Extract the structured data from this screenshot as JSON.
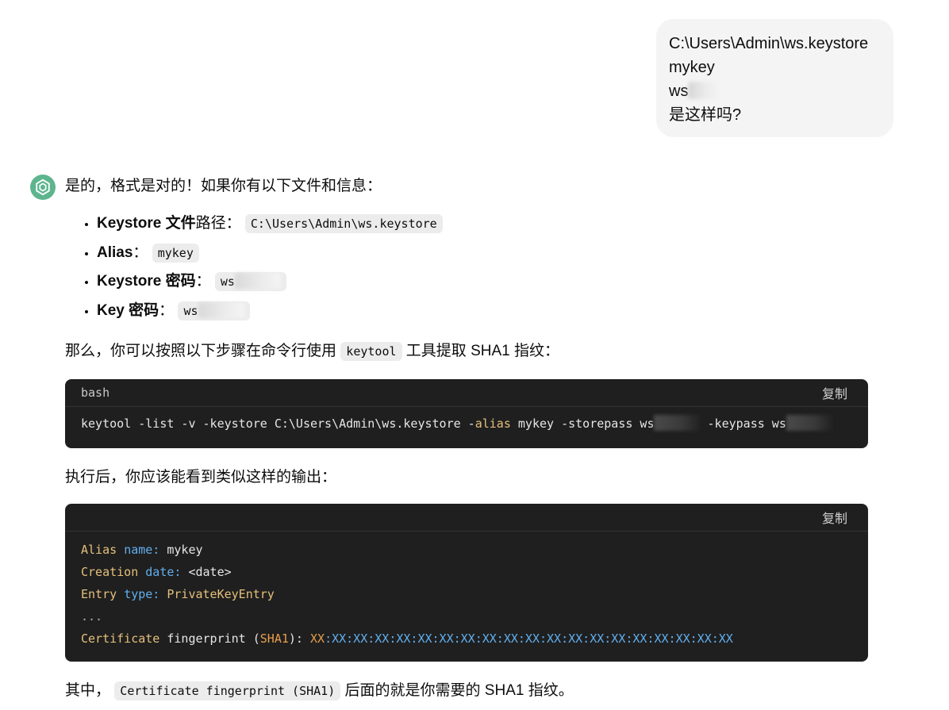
{
  "user_message": {
    "lines": [
      "C:\\Users\\Admin\\ws.keystore",
      "mykey",
      "ws",
      "是这样吗?"
    ]
  },
  "assistant": {
    "intro": "是的，格式是对的！如果你有以下文件和信息：",
    "items": [
      {
        "label_bold": "Keystore 文件",
        "label_rest": "路径：",
        "code": "C:\\Users\\Admin\\ws.keystore"
      },
      {
        "label_bold": "Alias",
        "label_rest": "：",
        "code": "mykey"
      },
      {
        "label_bold": "Keystore 密码",
        "label_rest": "：",
        "code": "ws"
      },
      {
        "label_bold": "Key 密码",
        "label_rest": "：",
        "code": "ws"
      }
    ],
    "step_prefix": "那么，你可以按照以下步骤在命令行使用",
    "step_code": "keytool",
    "step_suffix": "工具提取 SHA1 指纹：",
    "code1": {
      "lang": "bash",
      "copy_label": "复制",
      "cmd_part1": "keytool -list -v -keystore C:\\Users\\Admin\\ws.keystore -",
      "cmd_alias": "alias",
      "cmd_part2": " mykey -storepass ws",
      "cmd_part3": " -keypass ws"
    },
    "after_text": "执行后，你应该能看到类似这样的输出：",
    "code2": {
      "copy_label": "复制",
      "line1": {
        "k1": "Alias",
        "k2": "name:",
        "v": " mykey"
      },
      "line2": {
        "k1": "Creation",
        "k2": "date:",
        "v": " <date>"
      },
      "line3": {
        "k1": "Entry",
        "k2": "type:",
        "v": "PrivateKeyEntry"
      },
      "line4": "...",
      "line5": {
        "k1": "Certificate",
        "k2": " fingerprint (",
        "k3": "SHA1",
        "k4": "): ",
        "v1": "XX",
        "v2": ":XX:XX:XX:XX:XX:XX:XX:XX:XX:XX:XX:XX:XX:XX:XX:XX:XX:XX:XX"
      }
    },
    "final_prefix": "其中，",
    "final_code": "Certificate fingerprint (SHA1)",
    "final_suffix": "后面的就是你需要的 SHA1 指纹。"
  },
  "colors": {
    "avatar": "#5db58e",
    "code_bg": "#1f1f1f",
    "bubble_bg": "#f4f4f4"
  }
}
